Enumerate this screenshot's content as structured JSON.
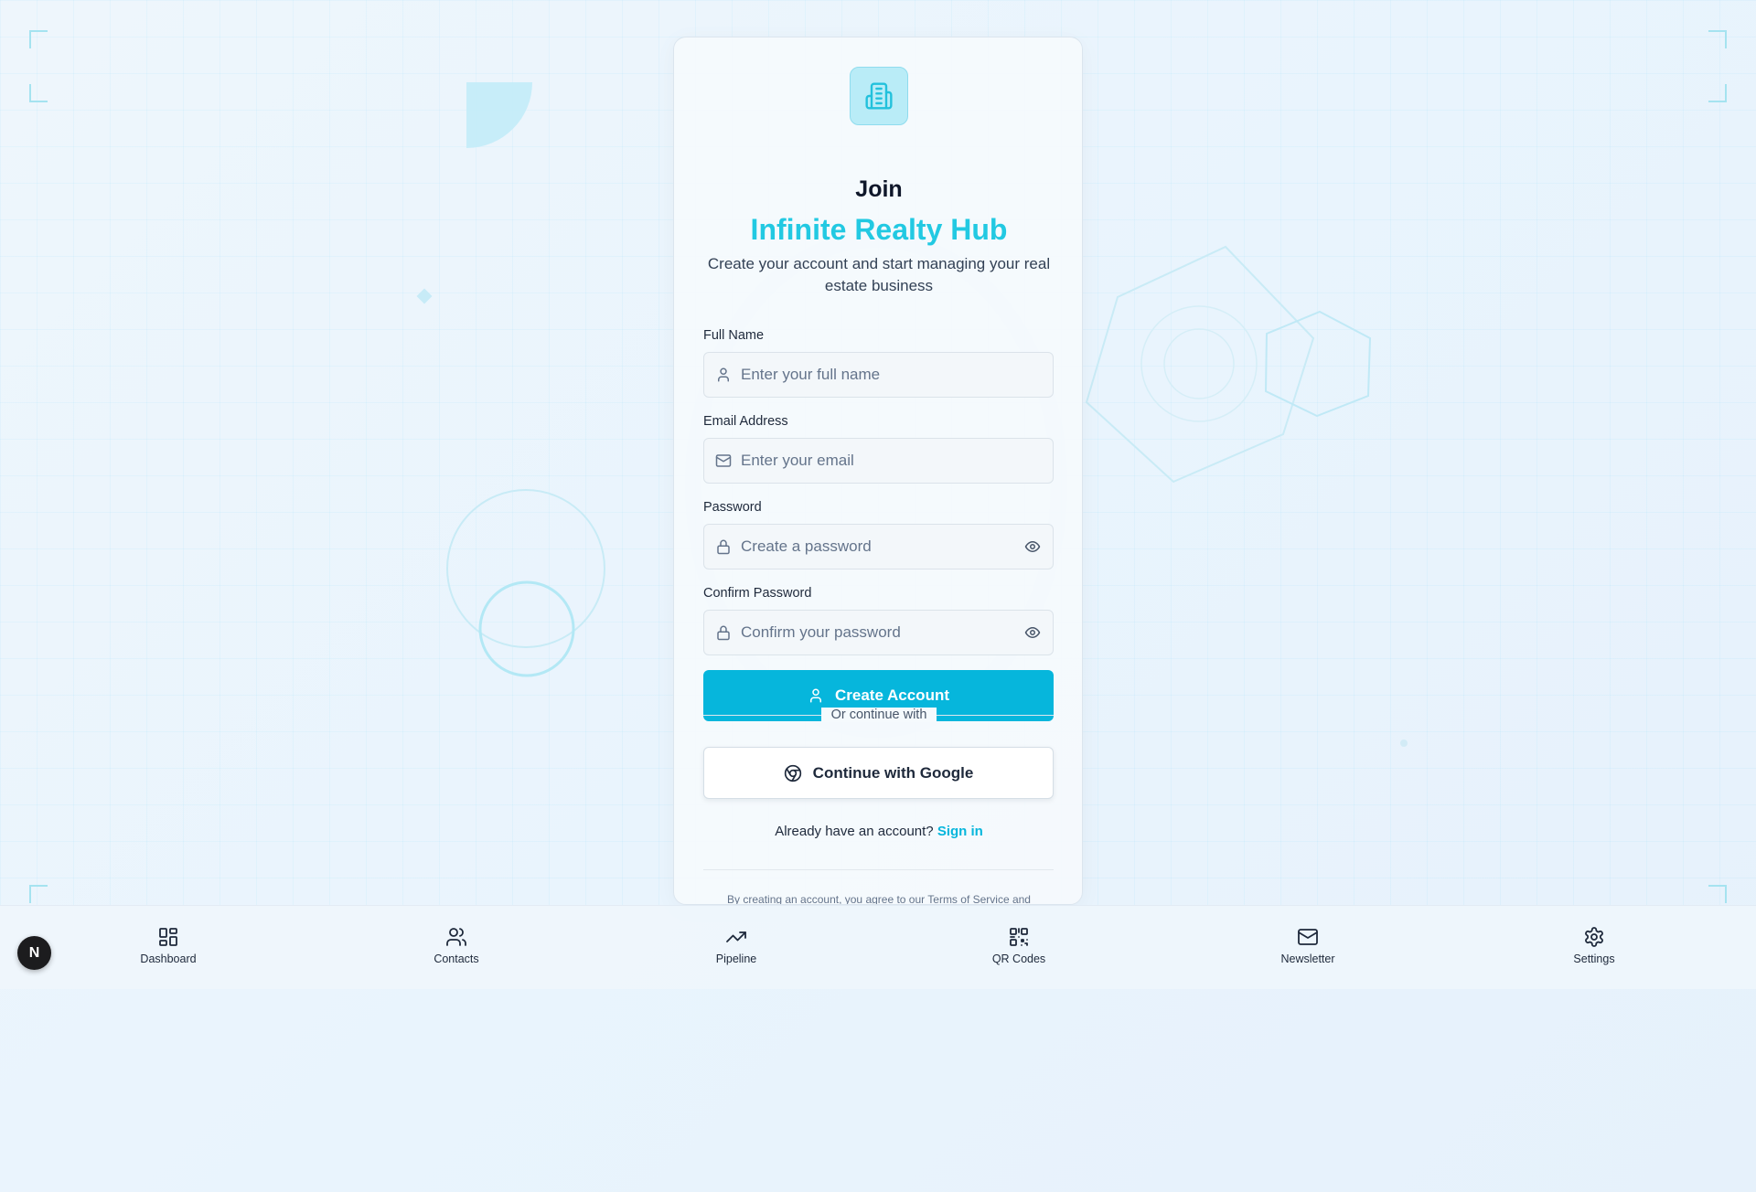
{
  "brand": {
    "join_label": "Join",
    "name": "Infinite Realty Hub",
    "subtitle": "Create your account and start managing your real estate business",
    "logo_icon": "building-icon",
    "accent_color": "#06b6dc"
  },
  "form": {
    "full_name": {
      "label": "Full Name",
      "placeholder": "Enter your full name",
      "value": ""
    },
    "email": {
      "label": "Email Address",
      "placeholder": "Enter your email",
      "value": ""
    },
    "password": {
      "label": "Password",
      "placeholder": "Create a password",
      "value": ""
    },
    "confirm_password": {
      "label": "Confirm Password",
      "placeholder": "Confirm your password",
      "value": ""
    },
    "submit_label": "Create Account",
    "divider_label": "Or continue with",
    "google_label": "Continue with Google",
    "signin_prompt": "Already have an account?",
    "signin_link": "Sign in",
    "terms_text": "By creating an account, you agree to our Terms of Service and"
  },
  "bottom_nav": {
    "items": [
      {
        "label": "Dashboard",
        "icon": "dashboard-icon"
      },
      {
        "label": "Contacts",
        "icon": "contacts-icon"
      },
      {
        "label": "Pipeline",
        "icon": "trending-up-icon"
      },
      {
        "label": "QR Codes",
        "icon": "qr-code-icon"
      },
      {
        "label": "Newsletter",
        "icon": "mail-icon"
      },
      {
        "label": "Settings",
        "icon": "gear-icon"
      }
    ]
  },
  "dev_badge": {
    "letter": "N"
  }
}
